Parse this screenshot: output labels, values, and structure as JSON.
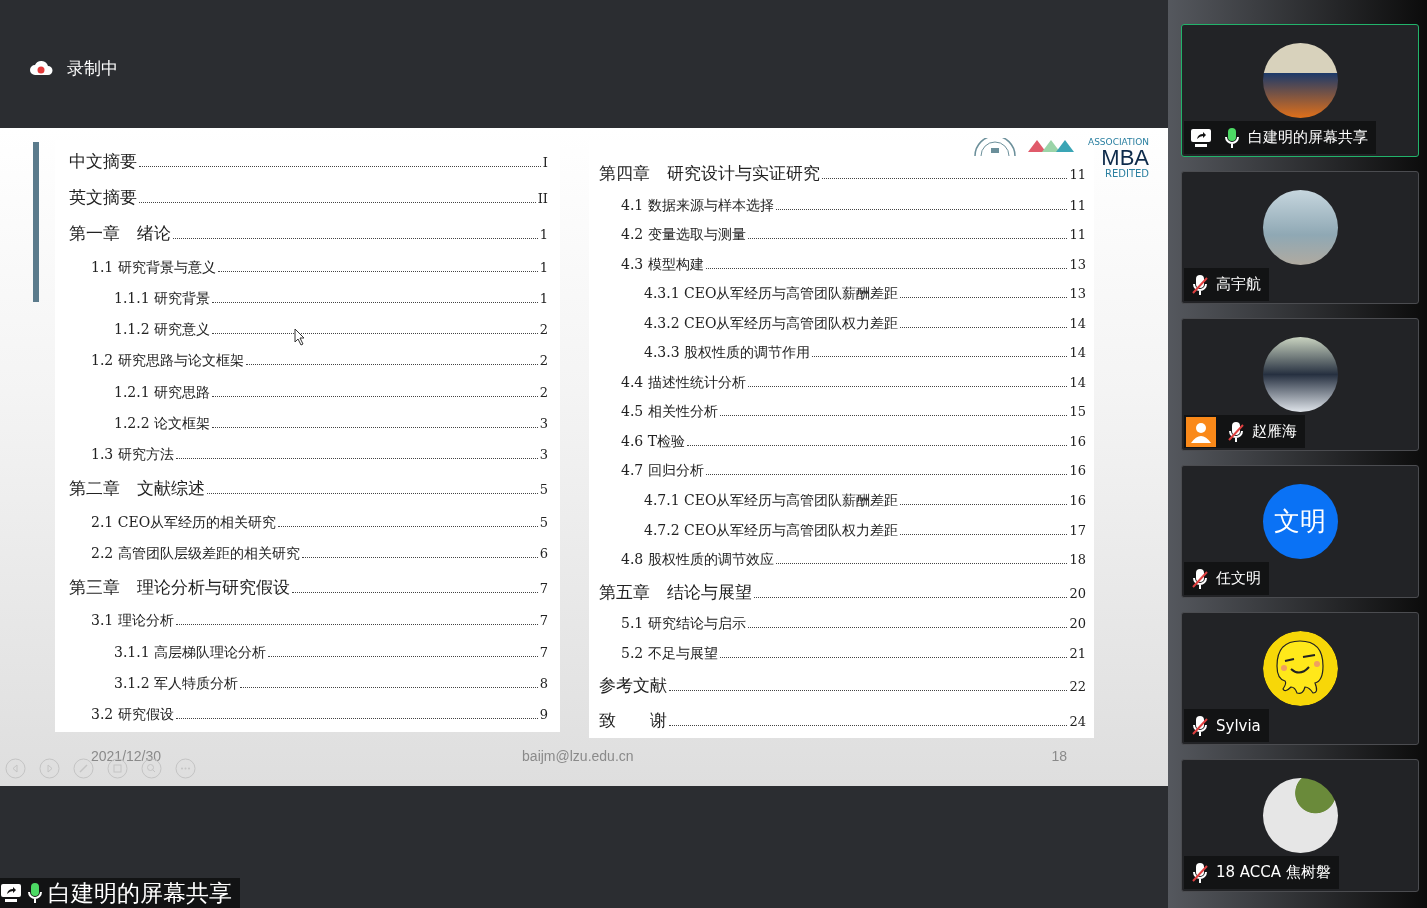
{
  "recording": {
    "label": "录制中"
  },
  "slide": {
    "left_page": [
      {
        "kind": "chapter",
        "title": "中文摘要",
        "page": "I"
      },
      {
        "kind": "chapter",
        "title": "英文摘要",
        "page": "II"
      },
      {
        "kind": "chapter",
        "title": "第一章　绪论",
        "page": "1"
      },
      {
        "kind": "section",
        "title": "1.1 研究背景与意义",
        "page": "1"
      },
      {
        "kind": "subsection",
        "title": "1.1.1 研究背景",
        "page": "1"
      },
      {
        "kind": "subsection",
        "title": "1.1.2 研究意义",
        "page": "2"
      },
      {
        "kind": "section",
        "title": "1.2 研究思路与论文框架",
        "page": "2"
      },
      {
        "kind": "subsection",
        "title": "1.2.1 研究思路",
        "page": "2"
      },
      {
        "kind": "subsection",
        "title": "1.2.2 论文框架",
        "page": "3"
      },
      {
        "kind": "section",
        "title": "1.3 研究方法",
        "page": "3"
      },
      {
        "kind": "chapter",
        "title": "第二章　文献综述",
        "page": "5"
      },
      {
        "kind": "section",
        "title": "2.1 CEO从军经历的相关研究",
        "page": "5"
      },
      {
        "kind": "section",
        "title": "2.2 高管团队层级差距的相关研究",
        "page": "6"
      },
      {
        "kind": "chapter",
        "title": "第三章　理论分析与研究假设",
        "page": "7"
      },
      {
        "kind": "section",
        "title": "3.1 理论分析",
        "page": "7"
      },
      {
        "kind": "subsection",
        "title": "3.1.1 高层梯队理论分析",
        "page": "7"
      },
      {
        "kind": "subsection",
        "title": "3.1.2 军人特质分析",
        "page": "8"
      },
      {
        "kind": "section",
        "title": "3.2 研究假设",
        "page": "9"
      }
    ],
    "right_page": [
      {
        "kind": "chapter",
        "title": "第四章　研究设计与实证研究",
        "page": "11"
      },
      {
        "kind": "section",
        "title": "4.1 数据来源与样本选择",
        "page": "11"
      },
      {
        "kind": "section",
        "title": "4.2 变量选取与测量",
        "page": "11"
      },
      {
        "kind": "section",
        "title": "4.3 模型构建",
        "page": "13"
      },
      {
        "kind": "subsection",
        "title": "4.3.1 CEO从军经历与高管团队薪酬差距",
        "page": "13"
      },
      {
        "kind": "subsection",
        "title": "4.3.2 CEO从军经历与高管团队权力差距",
        "page": "14"
      },
      {
        "kind": "subsection",
        "title": "4.3.3 股权性质的调节作用",
        "page": "14"
      },
      {
        "kind": "section",
        "title": "4.4 描述性统计分析",
        "page": "14"
      },
      {
        "kind": "section",
        "title": "4.5 相关性分析",
        "page": "15"
      },
      {
        "kind": "section",
        "title": "4.6 T检验",
        "page": "16"
      },
      {
        "kind": "section",
        "title": "4.7 回归分析",
        "page": "16"
      },
      {
        "kind": "subsection",
        "title": "4.7.1 CEO从军经历与高管团队薪酬差距",
        "page": "16"
      },
      {
        "kind": "subsection",
        "title": "4.7.2 CEO从军经历与高管团队权力差距",
        "page": "17"
      },
      {
        "kind": "section",
        "title": "4.8 股权性质的调节效应",
        "page": "18"
      },
      {
        "kind": "chapter",
        "title": "第五章　结论与展望",
        "page": "20"
      },
      {
        "kind": "section",
        "title": "5.1 研究结论与启示",
        "page": "20"
      },
      {
        "kind": "section",
        "title": "5.2 不足与展望",
        "page": "21"
      },
      {
        "kind": "chapter",
        "title": "参考文献",
        "page": "22"
      },
      {
        "kind": "chapter",
        "title": "致　　谢",
        "page": "24"
      }
    ],
    "logo": {
      "top_text": "ASSOCIATION",
      "main_text": "MBA",
      "bottom_text": "REDITED"
    },
    "footer": {
      "date": "2021/12/30",
      "email": "baijm@lzu.edu.cn",
      "page_number": "18"
    }
  },
  "participants": [
    {
      "name": "白建明的屏幕共享",
      "kind": "photo",
      "speaking": true,
      "sharing": true,
      "muted": false,
      "host": false
    },
    {
      "name": "高宇航",
      "kind": "photo",
      "speaking": false,
      "sharing": false,
      "muted": true,
      "host": false
    },
    {
      "name": "赵雁海",
      "kind": "photo",
      "speaking": false,
      "sharing": false,
      "muted": true,
      "host": true
    },
    {
      "name": "任文明",
      "kind": "initials",
      "initials": "文明",
      "speaking": false,
      "sharing": false,
      "muted": true,
      "host": false
    },
    {
      "name": "Sylvia",
      "kind": "cartoon",
      "speaking": false,
      "sharing": false,
      "muted": true,
      "host": false
    },
    {
      "name": "18 ACCA 焦树磐",
      "kind": "photo",
      "speaking": false,
      "sharing": false,
      "muted": true,
      "host": false
    }
  ],
  "presenter_label": {
    "name": "白建明的屏幕共享",
    "sharing": true,
    "muted": false
  }
}
